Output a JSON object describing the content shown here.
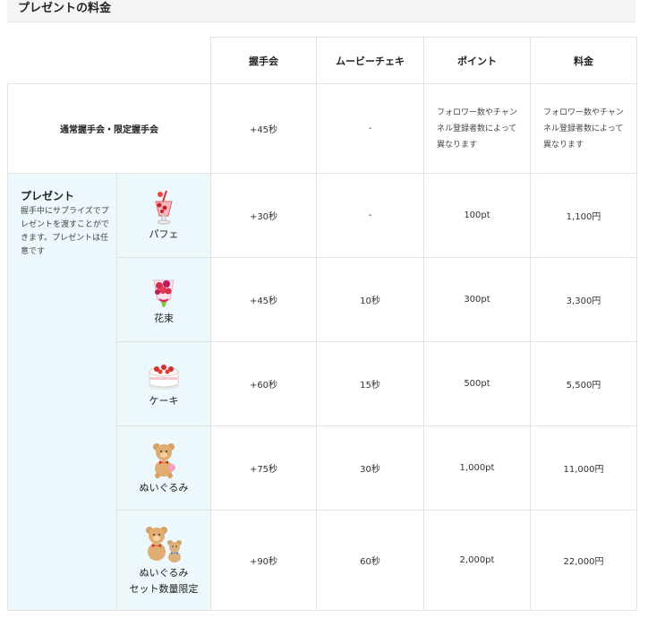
{
  "title": "プレゼントの料金",
  "columns": [
    "握手会",
    "ムービーチェキ",
    "ポイント",
    "料金"
  ],
  "normal_row": {
    "label": "通常握手会・限定握手会",
    "cells": [
      "+45秒",
      "-",
      "フォロワー数やチャンネル登録者数によって異なります",
      "フォロワー数やチャンネル登録者数によって異なります"
    ]
  },
  "present": {
    "title": "プレゼント",
    "description": "握手中にサプライズでプレゼントを渡すことができます。プレゼントは任意です",
    "items": [
      {
        "name": "パフェ",
        "sub": "",
        "icon": "parfait-icon",
        "cells": [
          "+30秒",
          "-",
          "100pt",
          "1,100円"
        ]
      },
      {
        "name": "花束",
        "sub": "",
        "icon": "bouquet-icon",
        "cells": [
          "+45秒",
          "10秒",
          "300pt",
          "3,300円"
        ]
      },
      {
        "name": "ケーキ",
        "sub": "",
        "icon": "cake-icon",
        "cells": [
          "+60秒",
          "15秒",
          "500pt",
          "5,500円"
        ]
      },
      {
        "name": "ぬいぐるみ",
        "sub": "",
        "icon": "teddy-bear-icon",
        "cells": [
          "+75秒",
          "30秒",
          "1,000pt",
          "11,000円"
        ]
      },
      {
        "name": "ぬいぐるみ",
        "sub": "セット数量限定",
        "icon": "teddy-bear-set-icon",
        "cells": [
          "+90秒",
          "60秒",
          "2,000pt",
          "22,000円"
        ]
      }
    ]
  },
  "colors": {
    "accent_bg": "#edf8fd",
    "border": "#e2e2e2",
    "heading_bg": "#f5f5f5"
  }
}
